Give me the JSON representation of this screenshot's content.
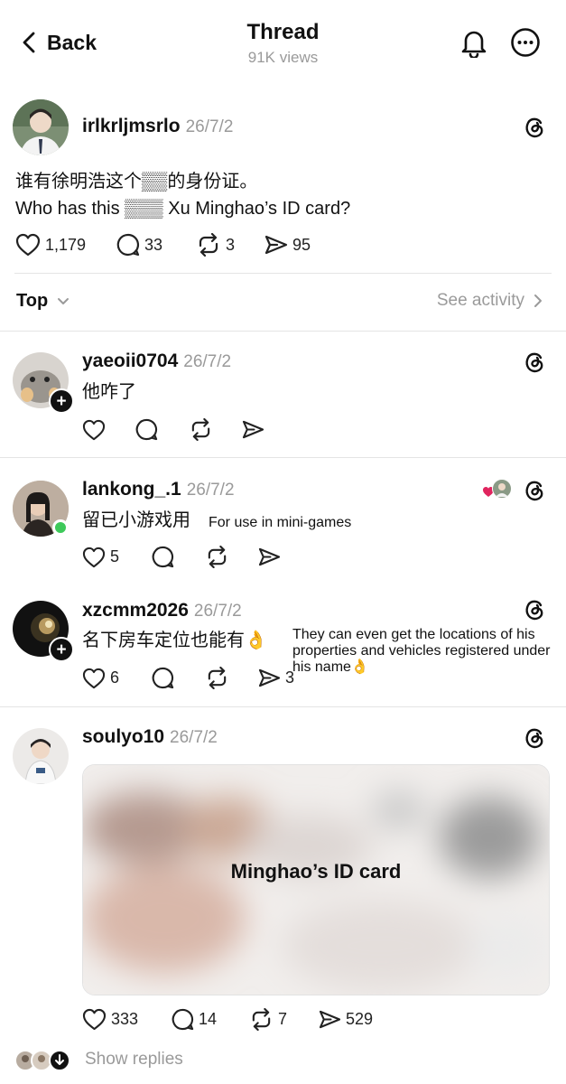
{
  "header": {
    "back_label": "Back",
    "title": "Thread",
    "views": "91K views"
  },
  "main_post": {
    "username": "irlkrljmsrlo",
    "date": "26/7/2",
    "text_cn": "谁有徐明浩这个▒▒的身份证。",
    "text_en": "Who has this ▒▒▒ Xu Minghao’s ID card?",
    "likes": "1,179",
    "comments": "33",
    "reposts": "3",
    "shares": "95"
  },
  "sort": {
    "label": "Top",
    "see_activity": "See activity"
  },
  "replies": [
    {
      "username": "yaeoii0704",
      "date": "26/7/2",
      "text": "他咋了",
      "likes": "",
      "comments": "",
      "reposts": "",
      "shares": ""
    },
    {
      "username": "lankong_.1",
      "date": "26/7/2",
      "text": "留已小游戏用",
      "note": "For use in mini-games",
      "likes": "5",
      "comments": "",
      "reposts": "",
      "shares": ""
    },
    {
      "username": "xzcmm2026",
      "date": "26/7/2",
      "text": "名下房车定位也能有👌",
      "note": "They can even get the locations of his properties and vehicles registered under his name👌",
      "likes": "6",
      "comments": "",
      "reposts": "",
      "shares": "3"
    },
    {
      "username": "soulyo10",
      "date": "26/7/2",
      "image_caption": "Minghao’s ID card",
      "likes": "333",
      "comments": "14",
      "reposts": "7",
      "shares": "529"
    }
  ],
  "show_replies": "Show replies",
  "colors": {
    "text": "#111111",
    "muted": "#9a9a9a",
    "divider": "#e4e4e4",
    "online": "#3ec95a",
    "heart": "#e0245e"
  },
  "icons": [
    "chevron-left-icon",
    "bell-icon",
    "more-icon",
    "threads-icon",
    "heart-icon",
    "comment-icon",
    "repost-icon",
    "share-icon",
    "chevron-down-icon",
    "chevron-right-icon"
  ]
}
